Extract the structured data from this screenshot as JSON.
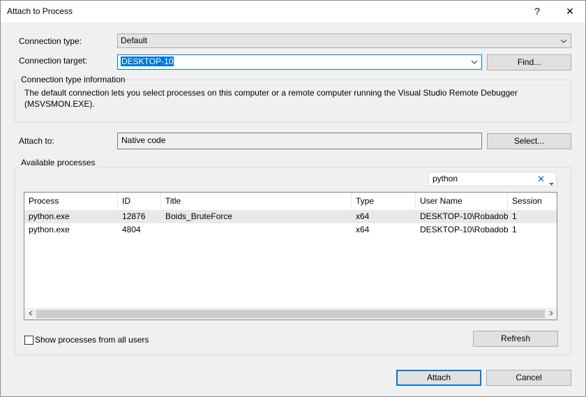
{
  "window": {
    "title": "Attach to Process",
    "help_label": "?",
    "close_label": "✕"
  },
  "connection": {
    "type_label": "Connection type:",
    "type_value": "Default",
    "target_label": "Connection target:",
    "target_value": "DESKTOP-10",
    "find_label": "Find..."
  },
  "info": {
    "group_label": "Connection type information",
    "text": "The default connection lets you select processes on this computer or a remote computer running the Visual Studio Remote Debugger (MSVSMON.EXE)."
  },
  "attach_to": {
    "label": "Attach to:",
    "value": "Native code",
    "select_label": "Select..."
  },
  "processes": {
    "group_label": "Available processes",
    "filter_value": "python",
    "filter_clear": "✕",
    "columns": [
      "Process",
      "ID",
      "Title",
      "Type",
      "User Name",
      "Session"
    ],
    "rows": [
      {
        "process": "python.exe",
        "id": "12876",
        "title": "Boids_BruteForce",
        "type": "x64",
        "user": "DESKTOP-10\\Robadob",
        "session": "1"
      },
      {
        "process": "python.exe",
        "id": "4804",
        "title": "",
        "type": "x64",
        "user": "DESKTOP-10\\Robadob",
        "session": "1"
      }
    ],
    "show_all_label": "Show processes from all users",
    "show_all_checked": false,
    "refresh_label": "Refresh"
  },
  "footer": {
    "attach_label": "Attach",
    "cancel_label": "Cancel"
  }
}
